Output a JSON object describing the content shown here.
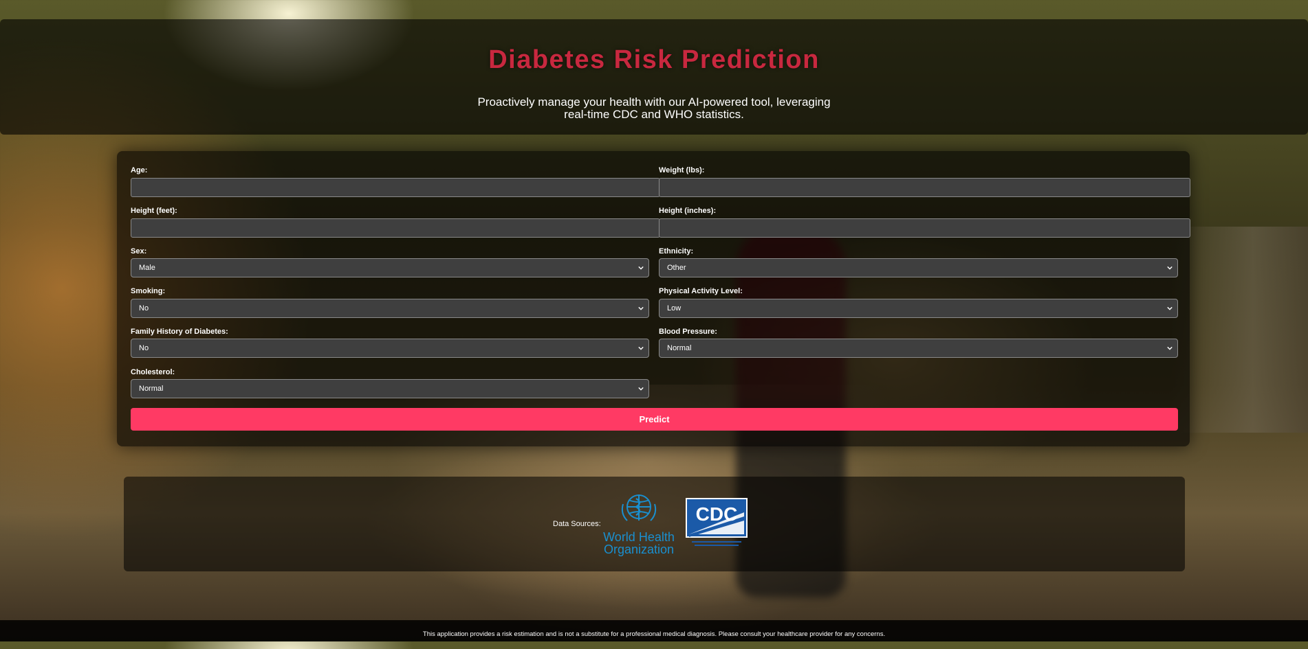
{
  "header": {
    "title": "Diabetes Risk Prediction",
    "subtitle": "Proactively manage your health with our AI-powered tool, leveraging real-time CDC and WHO statistics."
  },
  "form": {
    "age": {
      "label": "Age:",
      "value": ""
    },
    "weight": {
      "label": "Weight (lbs):",
      "value": ""
    },
    "height_feet": {
      "label": "Height (feet):",
      "value": ""
    },
    "height_inches": {
      "label": "Height (inches):",
      "value": ""
    },
    "sex": {
      "label": "Sex:",
      "value": "Male"
    },
    "ethnicity": {
      "label": "Ethnicity:",
      "value": "Other"
    },
    "smoking": {
      "label": "Smoking:",
      "value": "No"
    },
    "activity": {
      "label": "Physical Activity Level:",
      "value": "Low"
    },
    "family_history": {
      "label": "Family History of Diabetes:",
      "value": "No"
    },
    "blood_pressure": {
      "label": "Blood Pressure:",
      "value": "Normal"
    },
    "cholesterol": {
      "label": "Cholesterol:",
      "value": "Normal"
    },
    "submit_label": "Predict"
  },
  "sources": {
    "label": "Data Sources:",
    "who_logo_text": [
      "World Health",
      "Organization"
    ],
    "cdc_logo_text": "CDC",
    "colors": {
      "who_blue": "#1a8fcf",
      "cdc_blue": "#1b5aa8"
    }
  },
  "footer": {
    "disclaimer": "This application provides a risk estimation and is not a substitute for a professional medical diagnosis. Please consult your healthcare provider for any concerns."
  },
  "colors": {
    "title": "#c8283f",
    "accent_button": "#ff3a64"
  }
}
